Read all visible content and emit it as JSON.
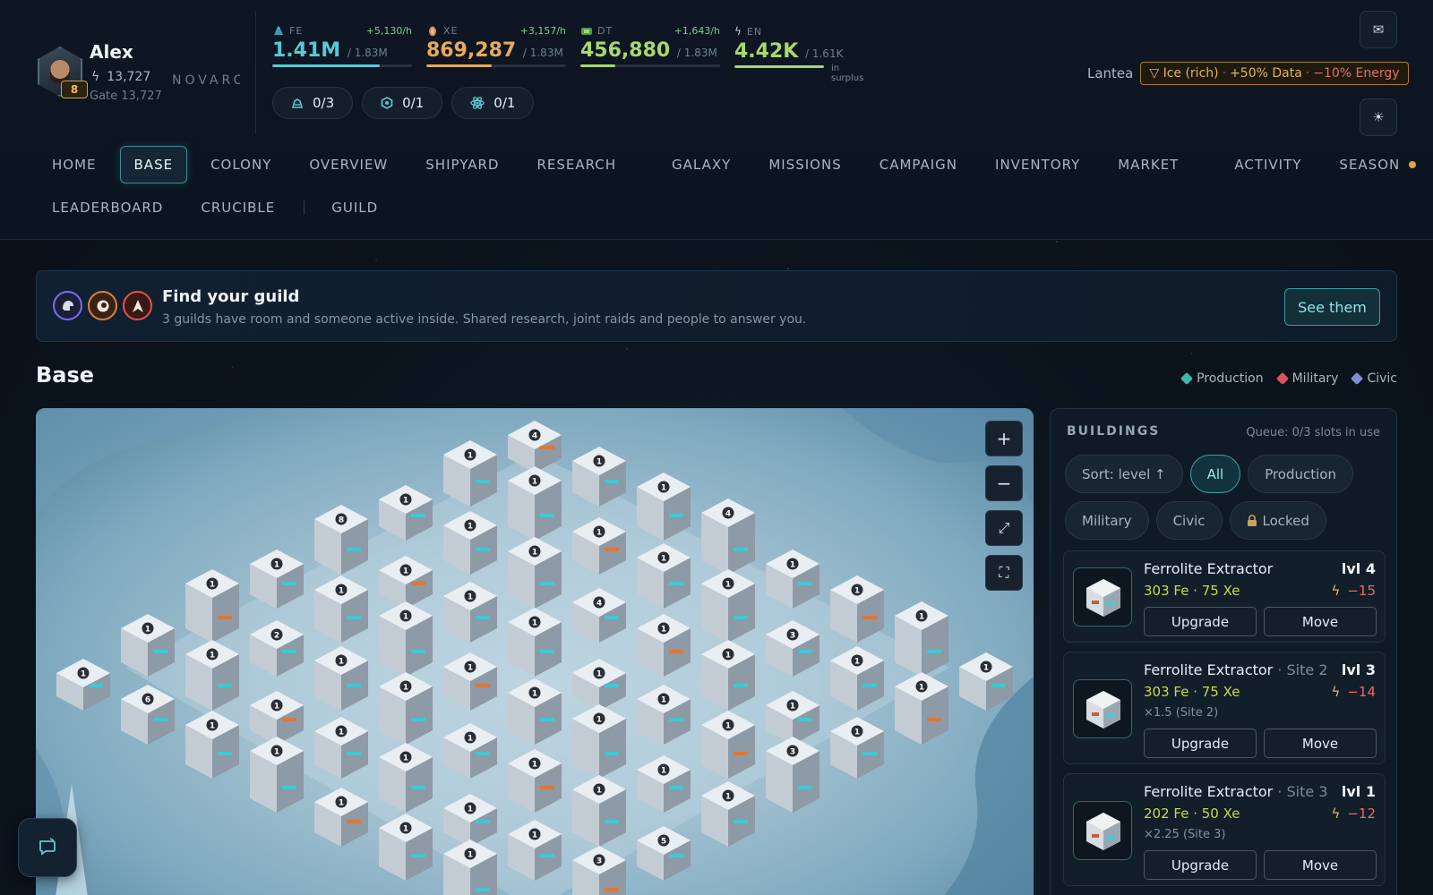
{
  "player": {
    "name": "Alex",
    "power": "13,727",
    "gate": "Gate 13,727",
    "level": "8",
    "faction": "NOVARC"
  },
  "resources": [
    {
      "code": "FE",
      "rate": "+5,130/h",
      "value": "1.41M",
      "cap": "/ 1.83M",
      "fill": 0.77,
      "color": "#59c9d6",
      "icon": "ferrolite-icon"
    },
    {
      "code": "XE",
      "rate": "+3,157/h",
      "value": "869,287",
      "cap": "/ 1.83M",
      "fill": 0.47,
      "color": "#e8a95a",
      "icon": "xenium-icon"
    },
    {
      "code": "DT",
      "rate": "+1,643/h",
      "value": "456,880",
      "cap": "/ 1.83M",
      "fill": 0.25,
      "color": "#a9d86a",
      "icon": "data-icon"
    },
    {
      "code": "EN",
      "rate": "",
      "value": "4.42K",
      "cap": "/ 1.61K",
      "fill": 1.0,
      "color": "#a9d86a",
      "icon": "energy-icon",
      "note": "in surplus"
    }
  ],
  "queues": [
    {
      "label": "0/3",
      "icon": "build-queue-icon"
    },
    {
      "label": "0/1",
      "icon": "research-queue-icon"
    },
    {
      "label": "0/1",
      "icon": "atom-queue-icon"
    }
  ],
  "planet": {
    "name": "Lantea",
    "biome": "▽ Ice (rich)",
    "sep": "·",
    "bonus": "+50% Data",
    "malus": "−10% Energy"
  },
  "header_icons": {
    "mail": "✉",
    "settings": "☀"
  },
  "nav": {
    "row1": [
      "HOME",
      "BASE",
      "COLONY",
      "OVERVIEW",
      "SHIPYARD",
      "RESEARCH",
      "GALAXY",
      "MISSIONS",
      "CAMPAIGN",
      "INVENTORY",
      "MARKET",
      "ACTIVITY",
      "SEASON"
    ],
    "row2": [
      "LEADERBOARD",
      "CRUCIBLE",
      "GUILD"
    ],
    "active": "BASE"
  },
  "guild_banner": {
    "title": "Find your guild",
    "subtitle": "3 guilds have room and someone active inside. Shared research, joint raids and people to answer you.",
    "button": "See them"
  },
  "base": {
    "title": "Base",
    "legend": [
      {
        "label": "Production",
        "color": "#3fb8a8"
      },
      {
        "label": "Military",
        "color": "#d9545f"
      },
      {
        "label": "Civic",
        "color": "#7d8fd4"
      }
    ]
  },
  "map_controls": [
    "+",
    "−",
    "⤢",
    "⛶"
  ],
  "buildings_panel": {
    "title": "BUILDINGS",
    "queue": "Queue: 0/3 slots in use",
    "filters": [
      {
        "label": "Sort: level ↑",
        "active": false
      },
      {
        "label": "All",
        "active": true
      },
      {
        "label": "Production",
        "active": false
      },
      {
        "label": "Military",
        "active": false
      },
      {
        "label": "Civic",
        "active": false
      },
      {
        "label": "Locked",
        "active": false,
        "icon": "lock-icon"
      }
    ],
    "cards": [
      {
        "name": "Ferrolite Extractor",
        "site": "",
        "level": "lvl 4",
        "cost": "303 Fe · 75 Xe",
        "energy": "−15",
        "multiplier": "",
        "upgrade": "Upgrade",
        "move": "Move"
      },
      {
        "name": "Ferrolite Extractor",
        "site": " · Site 2",
        "level": "lvl 3",
        "cost": "303 Fe · 75 Xe",
        "energy": "−14",
        "multiplier": "×1.5 (Site 2)",
        "upgrade": "Upgrade",
        "move": "Move"
      },
      {
        "name": "Ferrolite Extractor",
        "site": " · Site 3",
        "level": "lvl 1",
        "cost": "202 Fe · 50 Xe",
        "energy": "−12",
        "multiplier": "×2.25 (Site 3)",
        "upgrade": "Upgrade",
        "move": "Move"
      }
    ]
  },
  "map_building_levels": [
    "4",
    "1",
    "1",
    "4",
    "1",
    "1",
    "1",
    "1",
    "1",
    "1",
    "1",
    "1",
    "1",
    "3",
    "1",
    "1",
    "1",
    "1",
    "1",
    "4",
    "1",
    "1",
    "1",
    "1",
    "8",
    "1",
    "1",
    "1",
    "1",
    "1",
    "1",
    "3",
    "1",
    "1",
    "1",
    "1",
    "1",
    "1",
    "1",
    "1",
    "1",
    "2",
    "1",
    "1",
    "1",
    "1",
    "1",
    "5",
    "1",
    "1",
    "1",
    "1",
    "1",
    "1",
    "1",
    "3",
    "1",
    "6",
    "1",
    "1",
    "1",
    "1",
    "1",
    "1"
  ]
}
